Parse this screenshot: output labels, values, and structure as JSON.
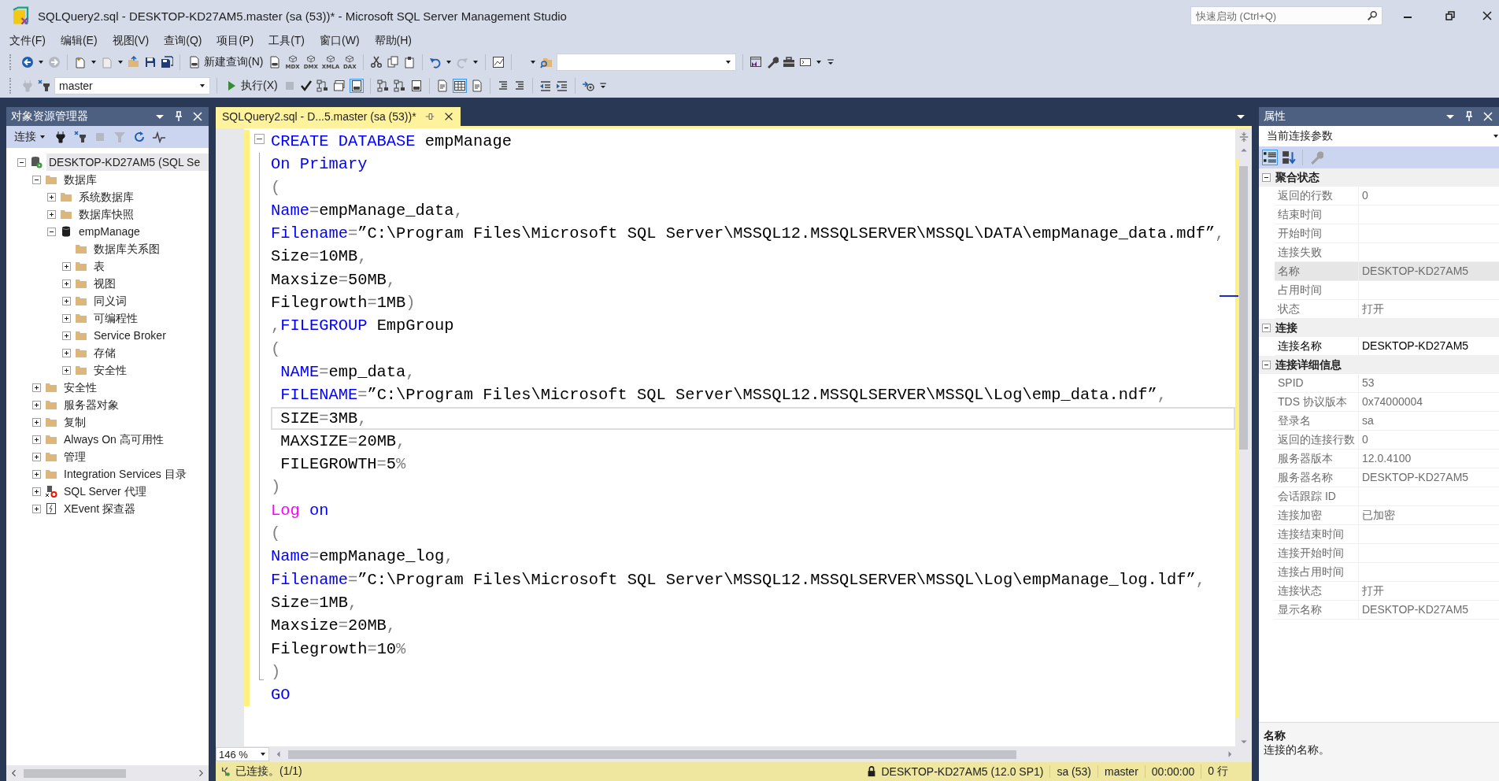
{
  "window": {
    "title": "SQLQuery2.sql - DESKTOP-KD27AM5.master (sa (53))* - Microsoft SQL Server Management Studio"
  },
  "quick_launch": {
    "placeholder": "快速启动 (Ctrl+Q)"
  },
  "menu": [
    "文件(F)",
    "编辑(E)",
    "视图(V)",
    "查询(Q)",
    "项目(P)",
    "工具(T)",
    "窗口(W)",
    "帮助(H)"
  ],
  "toolbar": {
    "new_query": "新建查询(N)",
    "query_types": [
      "MDX",
      "DMX",
      "XMLA",
      "DAX"
    ],
    "database": "master",
    "execute": "执行(X)"
  },
  "object_explorer": {
    "title": "对象资源管理器",
    "connect": "连接",
    "tree": [
      {
        "label": "DESKTOP-KD27AM5 (SQL Se",
        "kind": "server",
        "expandable": true,
        "expanded": true,
        "selected": true,
        "children": [
          {
            "label": "数据库",
            "kind": "folder",
            "expandable": true,
            "expanded": true,
            "selected": false,
            "children": [
              {
                "label": "系统数据库",
                "kind": "folder",
                "expandable": true,
                "expanded": false,
                "selected": false
              },
              {
                "label": "数据库快照",
                "kind": "folder",
                "expandable": true,
                "expanded": false,
                "selected": false
              },
              {
                "label": "empManage",
                "kind": "database",
                "expandable": true,
                "expanded": true,
                "selected": false,
                "children": [
                  {
                    "label": "数据库关系图",
                    "kind": "folder",
                    "selected": false
                  },
                  {
                    "label": "表",
                    "kind": "folder",
                    "expandable": true,
                    "expanded": false,
                    "selected": false
                  },
                  {
                    "label": "视图",
                    "kind": "folder",
                    "expandable": true,
                    "expanded": false,
                    "selected": false
                  },
                  {
                    "label": "同义词",
                    "kind": "folder",
                    "expandable": true,
                    "expanded": false,
                    "selected": false
                  },
                  {
                    "label": "可编程性",
                    "kind": "folder",
                    "expandable": true,
                    "expanded": false,
                    "selected": false
                  },
                  {
                    "label": "Service Broker",
                    "kind": "folder",
                    "expandable": true,
                    "expanded": false,
                    "selected": false
                  },
                  {
                    "label": "存储",
                    "kind": "folder",
                    "expandable": true,
                    "expanded": false,
                    "selected": false
                  },
                  {
                    "label": "安全性",
                    "kind": "folder",
                    "expandable": true,
                    "expanded": false,
                    "selected": false
                  }
                ]
              }
            ]
          },
          {
            "label": "安全性",
            "kind": "folder",
            "expandable": true,
            "expanded": false,
            "selected": false
          },
          {
            "label": "服务器对象",
            "kind": "folder",
            "expandable": true,
            "expanded": false,
            "selected": false
          },
          {
            "label": "复制",
            "kind": "folder",
            "expandable": true,
            "expanded": false,
            "selected": false
          },
          {
            "label": "Always On 高可用性",
            "kind": "folder",
            "expandable": true,
            "expanded": false,
            "selected": false
          },
          {
            "label": "管理",
            "kind": "folder",
            "expandable": true,
            "expanded": false,
            "selected": false
          },
          {
            "label": "Integration Services 目录",
            "kind": "folder",
            "expandable": true,
            "expanded": false,
            "selected": false
          },
          {
            "label": "SQL Server 代理",
            "kind": "agent",
            "expandable": true,
            "expanded": false,
            "selected": false
          },
          {
            "label": "XEvent 探查器",
            "kind": "xevent",
            "expandable": true,
            "expanded": false,
            "selected": false
          }
        ]
      }
    ]
  },
  "editor": {
    "tab": "SQLQuery2.sql - D...5.master (sa (53))*",
    "outline_expanded": true,
    "zoom": "146 %",
    "lines": [
      {
        "kind": "start",
        "changed": true,
        "current": false,
        "spans": [
          {
            "kind": "keyword",
            "text": "CREATE DATABASE"
          },
          {
            "kind": "plain",
            "text": " empManage"
          }
        ]
      },
      {
        "kind": "inner",
        "changed": true,
        "current": false,
        "spans": [
          {
            "kind": "keyword",
            "text": "On Primary"
          }
        ]
      },
      {
        "kind": "inner",
        "changed": true,
        "current": false,
        "spans": [
          {
            "kind": "operator",
            "text": "("
          }
        ]
      },
      {
        "kind": "inner",
        "changed": true,
        "current": false,
        "spans": [
          {
            "kind": "keyword",
            "text": "Name"
          },
          {
            "kind": "operator",
            "text": "="
          },
          {
            "kind": "plain",
            "text": "empManage_data"
          },
          {
            "kind": "operator",
            "text": ","
          }
        ]
      },
      {
        "kind": "inner",
        "changed": true,
        "current": false,
        "spans": [
          {
            "kind": "keyword",
            "text": "Filename"
          },
          {
            "kind": "operator",
            "text": "="
          },
          {
            "kind": "plain",
            "text": "”C:\\Program Files\\Microsoft SQL Server\\MSSQL12.MSSQLSERVER\\MSSQL\\DATA\\empManage_data.mdf”"
          },
          {
            "kind": "operator",
            "text": ","
          }
        ]
      },
      {
        "kind": "inner",
        "changed": true,
        "current": false,
        "spans": [
          {
            "kind": "plain",
            "text": "Size"
          },
          {
            "kind": "operator",
            "text": "="
          },
          {
            "kind": "plain",
            "text": "10MB"
          },
          {
            "kind": "operator",
            "text": ","
          }
        ]
      },
      {
        "kind": "inner",
        "changed": true,
        "current": false,
        "spans": [
          {
            "kind": "plain",
            "text": "Maxsize"
          },
          {
            "kind": "operator",
            "text": "="
          },
          {
            "kind": "plain",
            "text": "50MB"
          },
          {
            "kind": "operator",
            "text": ","
          }
        ]
      },
      {
        "kind": "inner",
        "changed": true,
        "current": false,
        "spans": [
          {
            "kind": "plain",
            "text": "Filegrowth"
          },
          {
            "kind": "operator",
            "text": "="
          },
          {
            "kind": "plain",
            "text": "1MB"
          },
          {
            "kind": "operator",
            "text": ")"
          }
        ]
      },
      {
        "kind": "inner",
        "changed": true,
        "current": false,
        "spans": [
          {
            "kind": "operator",
            "text": ","
          },
          {
            "kind": "keyword",
            "text": "FILEGROUP"
          },
          {
            "kind": "plain",
            "text": " EmpGroup"
          }
        ]
      },
      {
        "kind": "inner",
        "changed": true,
        "current": false,
        "spans": [
          {
            "kind": "operator",
            "text": "("
          }
        ]
      },
      {
        "kind": "inner",
        "changed": true,
        "current": false,
        "spans": [
          {
            "kind": "keyword",
            "text": " NAME"
          },
          {
            "kind": "operator",
            "text": "="
          },
          {
            "kind": "plain",
            "text": "emp_data"
          },
          {
            "kind": "operator",
            "text": ","
          }
        ]
      },
      {
        "kind": "inner",
        "changed": true,
        "current": false,
        "spans": [
          {
            "kind": "keyword",
            "text": " FILENAME"
          },
          {
            "kind": "operator",
            "text": "="
          },
          {
            "kind": "plain",
            "text": "”C:\\Program Files\\Microsoft SQL Server\\MSSQL12.MSSQLSERVER\\MSSQL\\Log\\emp_data.ndf”"
          },
          {
            "kind": "operator",
            "text": ","
          }
        ]
      },
      {
        "kind": "inner",
        "changed": true,
        "current": true,
        "spans": [
          {
            "kind": "plain",
            "text": " SIZE"
          },
          {
            "kind": "operator",
            "text": "="
          },
          {
            "kind": "plain",
            "text": "3MB"
          },
          {
            "kind": "operator",
            "text": ","
          }
        ]
      },
      {
        "kind": "inner",
        "changed": true,
        "current": false,
        "spans": [
          {
            "kind": "plain",
            "text": " MAXSIZE"
          },
          {
            "kind": "operator",
            "text": "="
          },
          {
            "kind": "plain",
            "text": "20MB"
          },
          {
            "kind": "operator",
            "text": ","
          }
        ]
      },
      {
        "kind": "inner",
        "changed": true,
        "current": false,
        "spans": [
          {
            "kind": "plain",
            "text": " FILEGROWTH"
          },
          {
            "kind": "operator",
            "text": "="
          },
          {
            "kind": "plain",
            "text": "5"
          },
          {
            "kind": "operator",
            "text": "%"
          }
        ]
      },
      {
        "kind": "inner",
        "changed": true,
        "current": false,
        "spans": [
          {
            "kind": "operator",
            "text": ")"
          }
        ]
      },
      {
        "kind": "inner",
        "changed": true,
        "current": false,
        "spans": [
          {
            "kind": "function",
            "text": "Log"
          },
          {
            "kind": "keyword",
            "text": " on"
          }
        ]
      },
      {
        "kind": "inner",
        "changed": true,
        "current": false,
        "spans": [
          {
            "kind": "operator",
            "text": "("
          }
        ]
      },
      {
        "kind": "inner",
        "changed": true,
        "current": false,
        "spans": [
          {
            "kind": "keyword",
            "text": "Name"
          },
          {
            "kind": "operator",
            "text": "="
          },
          {
            "kind": "plain",
            "text": "empManage_log"
          },
          {
            "kind": "operator",
            "text": ","
          }
        ]
      },
      {
        "kind": "inner",
        "changed": true,
        "current": false,
        "spans": [
          {
            "kind": "keyword",
            "text": "Filename"
          },
          {
            "kind": "operator",
            "text": "="
          },
          {
            "kind": "plain",
            "text": "”C:\\Program Files\\Microsoft SQL Server\\MSSQL12.MSSQLSERVER\\MSSQL\\Log\\empManage_log.ldf”"
          },
          {
            "kind": "operator",
            "text": ","
          }
        ]
      },
      {
        "kind": "inner",
        "changed": true,
        "current": false,
        "spans": [
          {
            "kind": "plain",
            "text": "Size"
          },
          {
            "kind": "operator",
            "text": "="
          },
          {
            "kind": "plain",
            "text": "1MB"
          },
          {
            "kind": "operator",
            "text": ","
          }
        ]
      },
      {
        "kind": "inner",
        "changed": true,
        "current": false,
        "spans": [
          {
            "kind": "plain",
            "text": "Maxsize"
          },
          {
            "kind": "operator",
            "text": "="
          },
          {
            "kind": "plain",
            "text": "20MB"
          },
          {
            "kind": "operator",
            "text": ","
          }
        ]
      },
      {
        "kind": "inner",
        "changed": true,
        "current": false,
        "spans": [
          {
            "kind": "plain",
            "text": "Filegrowth"
          },
          {
            "kind": "operator",
            "text": "="
          },
          {
            "kind": "plain",
            "text": "10"
          },
          {
            "kind": "operator",
            "text": "%"
          }
        ]
      },
      {
        "kind": "end",
        "changed": true,
        "current": false,
        "spans": [
          {
            "kind": "operator",
            "text": ")"
          }
        ]
      },
      {
        "kind": "after",
        "changed": true,
        "current": false,
        "spans": [
          {
            "kind": "keyword",
            "text": "GO"
          }
        ]
      }
    ]
  },
  "status_bar": {
    "connection": "已连接。(1/1)",
    "server": "DESKTOP-KD27AM5 (12.0 SP1)",
    "user": "sa (53)",
    "database": "master",
    "elapsed": "00:00:00",
    "rows": "0 行"
  },
  "properties": {
    "title": "属性",
    "object": "当前连接参数",
    "groups": [
      {
        "name": "聚合状态",
        "expanded": true,
        "rows": [
          {
            "name": "返回的行数",
            "value": "0",
            "readonly": true,
            "selected": false
          },
          {
            "name": "结束时间",
            "readonly": true,
            "selected": false
          },
          {
            "name": "开始时间",
            "readonly": true,
            "selected": false
          },
          {
            "name": "连接失败",
            "readonly": true,
            "selected": false
          },
          {
            "name": "名称",
            "value": "DESKTOP-KD27AM5",
            "readonly": true,
            "selected": true
          },
          {
            "name": "占用时间",
            "readonly": true,
            "selected": false
          },
          {
            "name": "状态",
            "value": "打开",
            "readonly": true,
            "selected": false
          }
        ]
      },
      {
        "name": "连接",
        "expanded": true,
        "rows": [
          {
            "name": "连接名称",
            "value": "DESKTOP-KD27AM5",
            "readonly": false,
            "selected": false
          }
        ]
      },
      {
        "name": "连接详细信息",
        "expanded": true,
        "rows": [
          {
            "name": "SPID",
            "value": "53",
            "readonly": true,
            "selected": false
          },
          {
            "name": "TDS 协议版本",
            "value": "0x74000004",
            "readonly": true,
            "selected": false
          },
          {
            "name": "登录名",
            "value": "sa",
            "readonly": true,
            "selected": false
          },
          {
            "name": "返回的连接行数",
            "value": "0",
            "readonly": true,
            "selected": false
          },
          {
            "name": "服务器版本",
            "value": "12.0.4100",
            "readonly": true,
            "selected": false
          },
          {
            "name": "服务器名称",
            "value": "DESKTOP-KD27AM5",
            "readonly": true,
            "selected": false
          },
          {
            "name": "会话跟踪 ID",
            "readonly": true,
            "selected": false
          },
          {
            "name": "连接加密",
            "value": "已加密",
            "readonly": true,
            "selected": false
          },
          {
            "name": "连接结束时间",
            "readonly": true,
            "selected": false
          },
          {
            "name": "连接开始时间",
            "readonly": true,
            "selected": false
          },
          {
            "name": "连接占用时间",
            "readonly": true,
            "selected": false
          },
          {
            "name": "连接状态",
            "value": "打开",
            "readonly": true,
            "selected": false
          },
          {
            "name": "显示名称",
            "value": "DESKTOP-KD27AM5",
            "readonly": true,
            "selected": false
          }
        ]
      }
    ],
    "description": {
      "title": "名称",
      "text": "连接的名称。"
    }
  }
}
